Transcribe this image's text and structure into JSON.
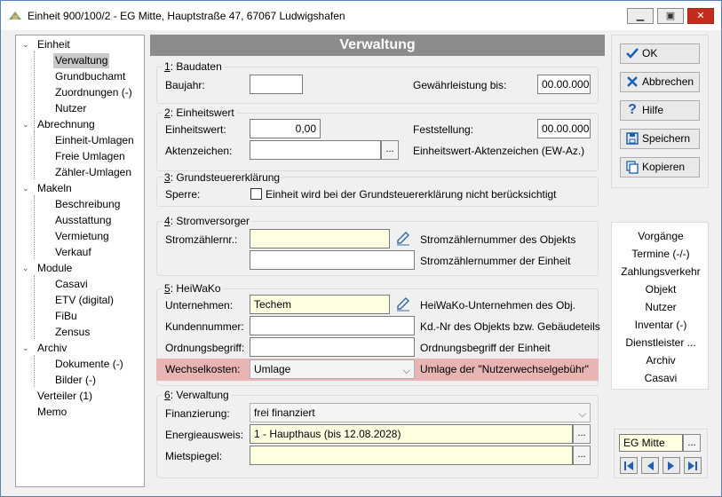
{
  "window": {
    "title": "Einheit 900/100/2 - EG Mitte, Hauptstraße 47, 67067 Ludwigshafen",
    "minimize_icon": "minimize-icon",
    "maximize_icon": "maximize-icon",
    "close_icon": "close-icon"
  },
  "tree": {
    "items": [
      {
        "label": "Einheit"
      },
      {
        "label": "Verwaltung"
      },
      {
        "label": "Grundbuchamt"
      },
      {
        "label": "Zuordnungen (-)"
      },
      {
        "label": "Nutzer"
      },
      {
        "label": "Abrechnung"
      },
      {
        "label": "Einheit-Umlagen"
      },
      {
        "label": "Freie Umlagen"
      },
      {
        "label": "Zähler-Umlagen"
      },
      {
        "label": "Makeln"
      },
      {
        "label": "Beschreibung"
      },
      {
        "label": "Ausstattung"
      },
      {
        "label": "Vermietung"
      },
      {
        "label": "Verkauf"
      },
      {
        "label": "Module"
      },
      {
        "label": "Casavi"
      },
      {
        "label": "ETV (digital)"
      },
      {
        "label": "FiBu"
      },
      {
        "label": "Zensus"
      },
      {
        "label": "Archiv"
      },
      {
        "label": "Dokumente (-)"
      },
      {
        "label": "Bilder (-)"
      },
      {
        "label": "Verteiler (1)"
      },
      {
        "label": "Memo"
      }
    ]
  },
  "main": {
    "header": "Verwaltung",
    "baudaten": {
      "title_num": "1",
      "title": ": Baudaten",
      "baujahr_label": "Baujahr:",
      "baujahr_value": "",
      "gewaehr_label": "Gewährleistung bis:",
      "gewaehr_value": "00.00.0000"
    },
    "einheitswert": {
      "title_num": "2",
      "title": ": Einheitswert",
      "ew_label": "Einheitswert:",
      "ew_value": "0,00",
      "fest_label": "Feststellung:",
      "fest_value": "00.00.0000",
      "az_label": "Aktenzeichen:",
      "az_value": "",
      "az_desc": "Einheitswert-Aktenzeichen (EW-Az.)"
    },
    "grundsteuer": {
      "title_num": "3",
      "title": ": Grundsteuererklärung",
      "sperre_label": "Sperre:",
      "sperre_checkbox_label": "Einheit wird bei der Grundsteuererklärung nicht berücksichtigt",
      "sperre_checked": false
    },
    "strom": {
      "title_num": "4",
      "title": ": Stromversorger",
      "nr_label": "Stromzählernr.:",
      "obj_value": "",
      "obj_desc": "Stromzählernummer des Objekts",
      "einheit_value": "",
      "einheit_desc": "Stromzählernummer der Einheit"
    },
    "heiwako": {
      "title_num": "5",
      "title": ": HeiWaKo",
      "unternehmen_label": "Unternehmen:",
      "unternehmen_value": "Techem",
      "unternehmen_desc": "HeiWaKo-Unternehmen des Obj.",
      "kunden_label": "Kundennummer:",
      "kunden_value": "",
      "kunden_desc": "Kd.-Nr des Objekts bzw. Gebäudeteils",
      "ordnung_label": "Ordnungsbegriff:",
      "ordnung_value": "",
      "ordnung_desc": "Ordnungsbegriff der Einheit",
      "wechsel_label": "Wechselkosten:",
      "wechsel_value": "Umlage",
      "wechsel_desc": "Umlage der \"Nutzerwechselgebühr\""
    },
    "verwaltung": {
      "title_num": "6",
      "title": ": Verwaltung",
      "finanz_label": "Finanzierung:",
      "finanz_value": "frei finanziert",
      "energie_label": "Energieausweis:",
      "energie_value": "1 - Haupthaus (bis 12.08.2028)",
      "miet_label": "Mietspiegel:",
      "miet_value": ""
    },
    "ellipsis": "..."
  },
  "actions": {
    "ok": "OK",
    "abbrechen": "Abbrechen",
    "hilfe": "Hilfe",
    "speichern": "Speichern",
    "kopieren": "Kopieren"
  },
  "links": [
    "Vorgänge",
    "Termine (-/-)",
    "Zahlungsverkehr",
    "Objekt",
    "Nutzer",
    "Inventar (-)",
    "Dienstleister ...",
    "Archiv",
    "Casavi"
  ],
  "nav": {
    "current": "EG Mitte",
    "ellipsis": "..."
  },
  "colors": {
    "header_bg": "#8c8c8c",
    "highlight": "#e8b4b4",
    "yellow_field": "#ffffe1",
    "ok_check": "#1a5fb4",
    "cancel_x": "#1a5fb4"
  }
}
